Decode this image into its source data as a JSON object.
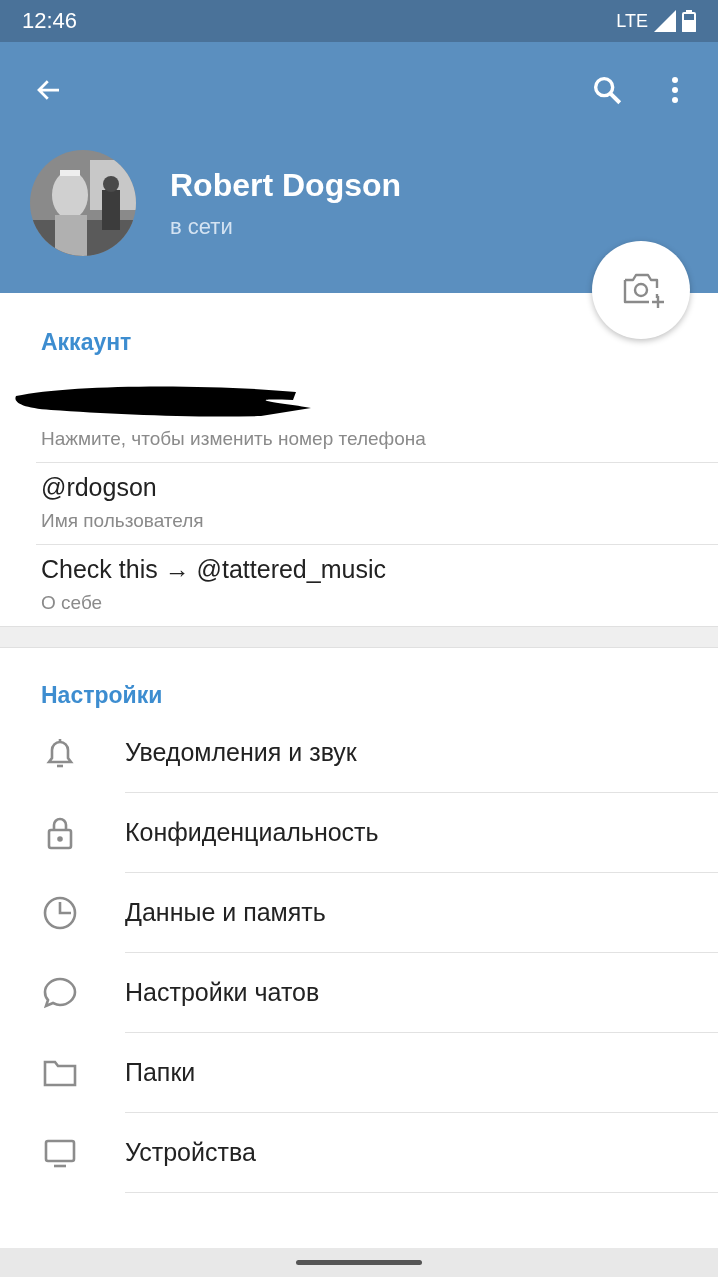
{
  "status_bar": {
    "time": "12:46",
    "network": "LTE"
  },
  "profile": {
    "name": "Robert Dogson",
    "status": "в сети"
  },
  "account": {
    "title": "Аккаунт",
    "rows": [
      {
        "kind": "redacted",
        "caption": "Нажмите, чтобы изменить номер телефона"
      },
      {
        "kind": "text",
        "value": "@rdogson",
        "caption": "Имя пользователя"
      },
      {
        "kind": "text",
        "value": "Check this → @tattered_music",
        "caption": "О себе"
      }
    ]
  },
  "settings": {
    "title": "Настройки",
    "items": [
      {
        "label": "Уведомления и звук"
      },
      {
        "label": "Конфиденциальность"
      },
      {
        "label": "Данные и память"
      },
      {
        "label": "Настройки чатов"
      },
      {
        "label": "Папки"
      },
      {
        "label": "Устройства"
      }
    ]
  }
}
